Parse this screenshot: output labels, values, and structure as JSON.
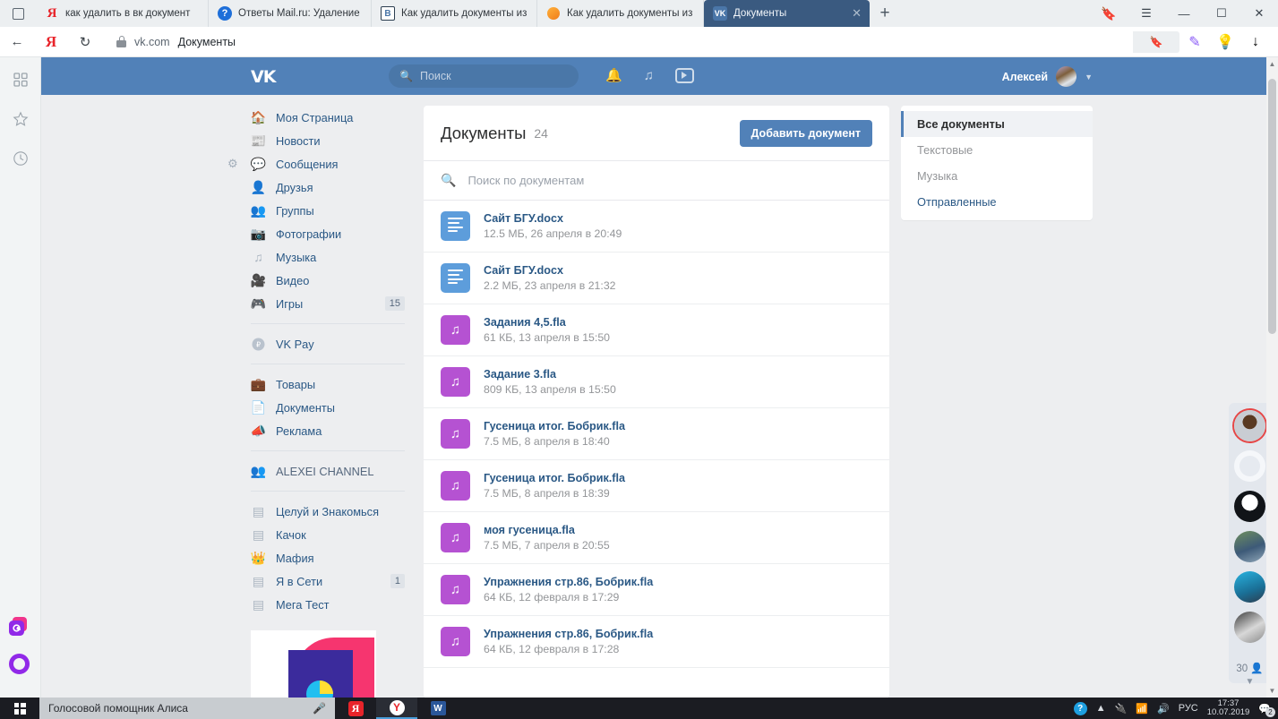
{
  "browser": {
    "tabs": [
      {
        "title": "как удалить в вк документ",
        "icon": "yandex-icon",
        "active": false
      },
      {
        "title": "Ответы Mail.ru: Удаление",
        "icon": "mailru-icon",
        "active": false
      },
      {
        "title": "Как удалить документы из",
        "icon": "vk-blue-icon",
        "active": false
      },
      {
        "title": "Как удалить документы из",
        "icon": "orange-circle-icon",
        "active": false
      },
      {
        "title": "Документы",
        "icon": "vk-icon",
        "active": true
      }
    ],
    "new_tab_label": "+",
    "close_label": "✕",
    "address": {
      "domain": "vk.com",
      "title": "Документы"
    },
    "window_controls": {
      "minimize": "—",
      "maximize": "☐",
      "close": "✕"
    },
    "rail_icons": [
      "apps-grid-icon",
      "bookmarks-star-icon",
      "history-clock-icon"
    ]
  },
  "vk": {
    "logo": "VK",
    "search": {
      "placeholder": "Поиск",
      "value": ""
    },
    "header_icons": [
      "bell-icon",
      "music-note-icon",
      "video-play-icon"
    ],
    "user": {
      "name": "Алексей"
    },
    "nav": [
      {
        "label": "Моя Страница",
        "icon": "home-icon",
        "badge": ""
      },
      {
        "label": "Новости",
        "icon": "news-icon",
        "badge": ""
      },
      {
        "label": "Сообщения",
        "icon": "chat-icon",
        "badge": "",
        "gear": true
      },
      {
        "label": "Друзья",
        "icon": "person-icon",
        "badge": ""
      },
      {
        "label": "Группы",
        "icon": "people-icon",
        "badge": ""
      },
      {
        "label": "Фотографии",
        "icon": "camera-icon",
        "badge": ""
      },
      {
        "label": "Музыка",
        "icon": "music-note-icon",
        "badge": ""
      },
      {
        "label": "Видео",
        "icon": "film-icon",
        "badge": ""
      },
      {
        "label": "Игры",
        "icon": "gamepad-icon",
        "badge": "15"
      }
    ],
    "nav_group2": [
      {
        "label": "VK Pay",
        "icon": "vkpay-icon",
        "badge": ""
      }
    ],
    "nav_group3": [
      {
        "label": "Товары",
        "icon": "bag-icon",
        "badge": ""
      },
      {
        "label": "Документы",
        "icon": "document-icon",
        "badge": ""
      },
      {
        "label": "Реклама",
        "icon": "megaphone-icon",
        "badge": ""
      }
    ],
    "nav_group4": [
      {
        "label": "ALEXEI CHANNEL",
        "icon": "people-icon",
        "badge": ""
      }
    ],
    "nav_group5": [
      {
        "label": "Целуй и Знакомься",
        "icon": "app-grid-icon",
        "badge": ""
      },
      {
        "label": "Качок",
        "icon": "app-grid-icon",
        "badge": ""
      },
      {
        "label": "Мафия",
        "icon": "crown-icon",
        "badge": ""
      },
      {
        "label": "Я в Сети",
        "icon": "app-grid-icon",
        "badge": "1"
      },
      {
        "label": "Мега Тест",
        "icon": "app-grid-icon",
        "badge": ""
      }
    ]
  },
  "main": {
    "title": "Документы",
    "count": "24",
    "add_button": "Добавить документ",
    "search_placeholder": "Поиск по документам",
    "documents": [
      {
        "name": "Сайт БГУ.docx",
        "meta": "12.5 МБ, 26 апреля в 20:49",
        "type": "doc"
      },
      {
        "name": "Сайт БГУ.docx",
        "meta": "2.2 МБ, 23 апреля в 21:32",
        "type": "doc"
      },
      {
        "name": "Задания 4,5.fla",
        "meta": "61 КБ, 13 апреля в 15:50",
        "type": "music"
      },
      {
        "name": "Задание 3.fla",
        "meta": "809 КБ, 13 апреля в 15:50",
        "type": "music"
      },
      {
        "name": "Гусеница итог. Бобрик.fla",
        "meta": "7.5 МБ, 8 апреля в 18:40",
        "type": "music"
      },
      {
        "name": "Гусеница итог. Бобрик.fla",
        "meta": "7.5 МБ, 8 апреля в 18:39",
        "type": "music"
      },
      {
        "name": "моя гусеница.fla",
        "meta": "7.5 МБ, 7 апреля в 20:55",
        "type": "music"
      },
      {
        "name": "Упражнения стр.86, Бобрик.fla",
        "meta": "64 КБ, 12 февраля в 17:29",
        "type": "music"
      },
      {
        "name": "Упражнения стр.86, Бобрик.fla",
        "meta": "64 КБ, 12 февраля в 17:28",
        "type": "music"
      }
    ]
  },
  "filters": [
    {
      "label": "Все документы",
      "state": "active"
    },
    {
      "label": "Текстовые",
      "state": "dim"
    },
    {
      "label": "Музыка",
      "state": "dim"
    },
    {
      "label": "Отправленные",
      "state": "link"
    }
  ],
  "friends_rail": {
    "count": "30",
    "avatars": [
      "avatar-cat",
      "avatar-dog",
      "avatar-blackwhite",
      "avatar-man",
      "avatar-woman",
      "avatar-girl"
    ]
  },
  "taskbar": {
    "search_placeholder": "Голосовой помощник Алиса",
    "apps": [
      "yandex-icon",
      "yandex-browser-icon",
      "word-icon"
    ],
    "tray": {
      "language": "РУС",
      "time": "17:37",
      "date": "10.07.2019",
      "notification_count": "2"
    }
  },
  "colors": {
    "vk_blue": "#5181b8",
    "link_blue": "#2a5885",
    "doc_icon": "#5d9ddb",
    "music_icon": "#b552d2",
    "page_bg": "#edeef0"
  }
}
